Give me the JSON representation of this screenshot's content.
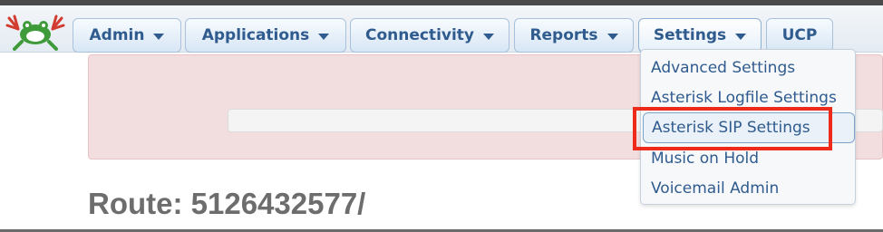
{
  "logo": {
    "icon": "frog-logo-icon"
  },
  "nav": {
    "items": [
      {
        "label": "Admin",
        "has_caret": true
      },
      {
        "label": "Applications",
        "has_caret": true
      },
      {
        "label": "Connectivity",
        "has_caret": true
      },
      {
        "label": "Reports",
        "has_caret": true
      },
      {
        "label": "Settings",
        "has_caret": true,
        "active": true
      },
      {
        "label": "UCP",
        "has_caret": false
      }
    ]
  },
  "settings_menu": {
    "items": [
      {
        "label": "Advanced Settings"
      },
      {
        "label": "Asterisk Logfile Settings"
      },
      {
        "label": "Asterisk SIP Settings",
        "highlighted": true
      },
      {
        "label": "Music on Hold"
      },
      {
        "label": "Voicemail Admin"
      }
    ]
  },
  "page": {
    "title": "Route: 5126432577/"
  },
  "colors": {
    "nav_text": "#2f5b8e",
    "alert_background": "#f2dede",
    "highlight_box": "#ee2b1a",
    "title_text": "#6d6d6d"
  }
}
